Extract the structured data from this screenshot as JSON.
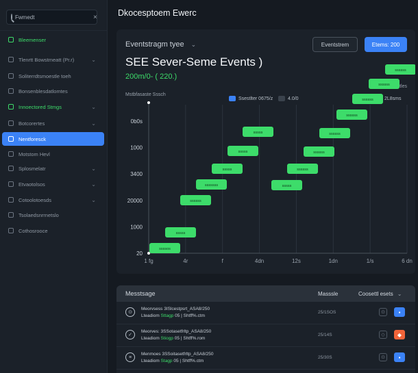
{
  "sidebar": {
    "search_value": "Fwmedt",
    "items": [
      {
        "label": "Bleemenser",
        "chevron": "",
        "style": "green"
      },
      {
        "label": "Tlenrtt Bowstmeatt (Pr.r)",
        "chevron": "⌄",
        "style": ""
      },
      {
        "label": "Soliterrdtsmoestle toeh",
        "chevron": "",
        "style": ""
      },
      {
        "label": "Bonsenblesdatlomtes",
        "chevron": "",
        "style": ""
      },
      {
        "label": "Innoectored Stmgs",
        "chevron": "⌄",
        "style": "green"
      },
      {
        "label": "Botcorertes",
        "chevron": "⌄",
        "style": ""
      },
      {
        "label": "Nentforesck",
        "chevron": "",
        "style": "active"
      },
      {
        "label": "Motstom Hevl",
        "chevron": "",
        "style": ""
      },
      {
        "label": "Splosmelatr",
        "chevron": "⌄",
        "style": ""
      },
      {
        "label": "Etvaotolsos",
        "chevron": "⌄",
        "style": ""
      },
      {
        "label": "Cotoolotoesds",
        "chevron": "⌄",
        "style": ""
      },
      {
        "label": "Tsolaedsnrrnetslo",
        "chevron": "",
        "style": ""
      },
      {
        "label": "Cothosrooce",
        "chevron": "",
        "style": ""
      }
    ]
  },
  "header": {
    "title": "Dkocesptoem Ewerc"
  },
  "chart_card": {
    "dropdown_label": "Eventstragm tyee",
    "btn_outline": "Eventstrem",
    "btn_primary": "Etems: 200",
    "heading": "SEE Sever-Seme Events )",
    "subheading": "200m/0-  (  220.)",
    "y_title": "Mstbfasaste Sssch",
    "legend_top": "Fvectstrl Seastles",
    "legend_a": "Ssestlter 0675/z",
    "legend_b": "4.0/0",
    "legend_c": "2L8sms",
    "series_color": "#3ddc6a",
    "accent": "#3b82f6"
  },
  "chart_data": {
    "type": "bar",
    "orientation": "horizontal-timeline",
    "y_ticks": [
      "0b0s",
      "1000",
      "3400",
      "20000",
      "1000",
      "20"
    ],
    "x_ticks": [
      "1 fg",
      "4r",
      "f",
      "4dn",
      "12s",
      "1dn",
      "1/s",
      "6 dn"
    ],
    "ylim": [
      0,
      6
    ],
    "xlim": [
      0,
      8
    ],
    "grid": true,
    "bars": [
      {
        "label": "ssssos",
        "x_start": 0.05,
        "x_end": 1.05,
        "y": 0.35
      },
      {
        "label": "sssss",
        "x_start": 1.05,
        "x_end": 2.05,
        "y": 1.2
      },
      {
        "label": "ssssss",
        "x_start": 2.0,
        "x_end": 3.0,
        "y": 2.05
      },
      {
        "label": "sssssss",
        "x_start": 3.0,
        "x_end": 4.0,
        "y": 2.85
      },
      {
        "label": "sssss",
        "x_start": 4.0,
        "x_end": 5.0,
        "y": 3.7
      },
      {
        "label": "sssss",
        "x_start": 4.95,
        "x_end": 5.95,
        "y": 4.55
      },
      {
        "label": "sssss",
        "x_start": 5.95,
        "x_end": 6.95,
        "y": 5.4
      },
      {
        "label": "sssss",
        "x_start": 7.9,
        "x_end": 8.9,
        "y": 6.25
      },
      {
        "label": "ssssss",
        "x_start": 5.95,
        "x_end": 7.0,
        "y": 3.75
      },
      {
        "label": "ssssss",
        "x_start": 6.95,
        "x_end": 8.0,
        "y": 4.6
      },
      {
        "label": "ssssss",
        "x_start": 7.95,
        "x_end": 9.0,
        "y": 5.45
      },
      {
        "label": "ssssss",
        "x_start": 8.95,
        "x_end": 10.0,
        "y": 6.25
      },
      {
        "label": "ssssss",
        "x_start": 9.95,
        "x_end": 11.0,
        "y": 7.05
      },
      {
        "label": "ssssss",
        "x_start": 10.95,
        "x_end": 12.0,
        "y": 7.9
      },
      {
        "label": "ssssss",
        "x_start": 11.95,
        "x_end": 13.0,
        "y": 8.7
      }
    ]
  },
  "table": {
    "col1": "Messtsage",
    "col2": "Masssle",
    "col3": "Coosettl esets",
    "rows": [
      {
        "icon": "clock-icon",
        "glyph": "⊙",
        "line1": "Meorvsess 3ISlcestpsrt_ASA8/250",
        "line2a": "Lteadiom ",
        "line2g": "Sttagp",
        "line2b": " 05 | Shtff%.ctm",
        "time": "25/1SOS",
        "action": "blue"
      },
      {
        "icon": "check-icon",
        "glyph": "✓",
        "line1": "Meorves: 3SSotasetfrltp_ASA8/250",
        "line2a": "Lteadiom ",
        "line2g": "Stiogp",
        "line2b": " 05 | Shtff%.rom",
        "time": "25/14S",
        "action": "orange"
      },
      {
        "icon": "list-icon",
        "glyph": "≡",
        "line1": "Menmoes 3SSoitasetfrltp_ASA8/250",
        "line2a": "Lteadiom ",
        "line2g": "Stagp",
        "line2b": " 05 | Shtff%.ctm",
        "time": "25/30S",
        "action": "blue"
      }
    ]
  }
}
